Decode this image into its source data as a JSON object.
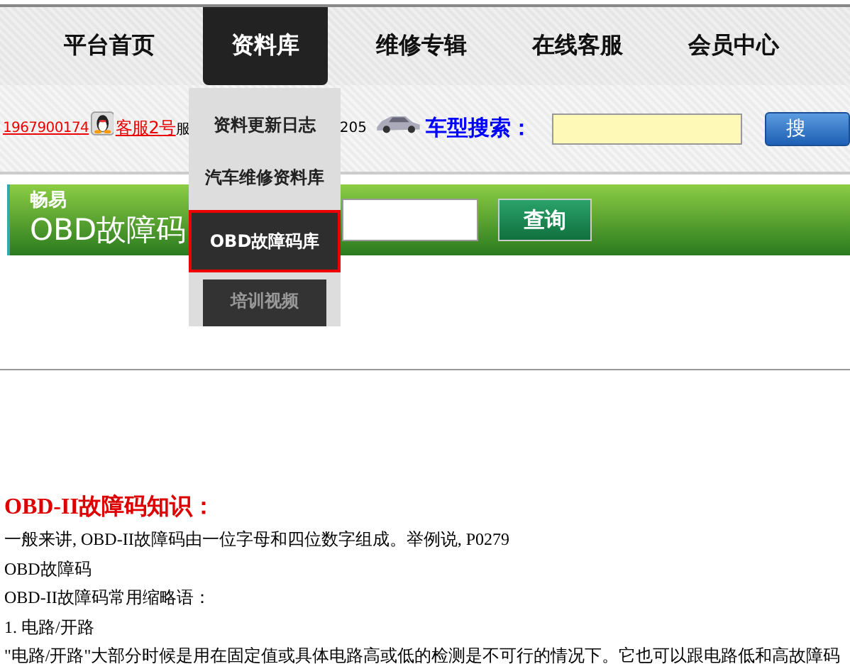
{
  "nav": [
    {
      "label": "平台首页",
      "selected": false
    },
    {
      "label": "资料库",
      "selected": true
    },
    {
      "label": "维修专辑",
      "selected": false
    },
    {
      "label": "在线客服",
      "selected": false
    },
    {
      "label": "会员中心",
      "selected": false
    }
  ],
  "info": {
    "qq_number": "1967900174",
    "service_link": "客服2号",
    "hotline_start": "服",
    "hotline_end": "205",
    "search_label": "车型搜索：",
    "search_button": "搜"
  },
  "dropdown": [
    {
      "label": "资料更新日志",
      "kind": "light",
      "selected": false
    },
    {
      "label": "汽车维修资料库",
      "kind": "light",
      "selected": false
    },
    {
      "label": "OBD故障码库",
      "kind": "light",
      "selected": true
    },
    {
      "label": "培训视频",
      "kind": "dark",
      "selected": false
    }
  ],
  "banner": {
    "brand": "畅易",
    "title": "OBD故障码",
    "button": "查询"
  },
  "article": {
    "heading": "OBD-II故障码知识：",
    "lines": [
      "一般来讲, OBD-II故障码由一位字母和四位数字组成。举例说, P0279",
      "OBD故障码",
      "OBD-II故障码常用缩略语：",
      "1. 电路/开路",
      "\"电路/开路\"大部分时候是用在固定值或具体电路高或低的检测是不可行的情况下。它也可以跟电路低和高故障码"
    ]
  }
}
